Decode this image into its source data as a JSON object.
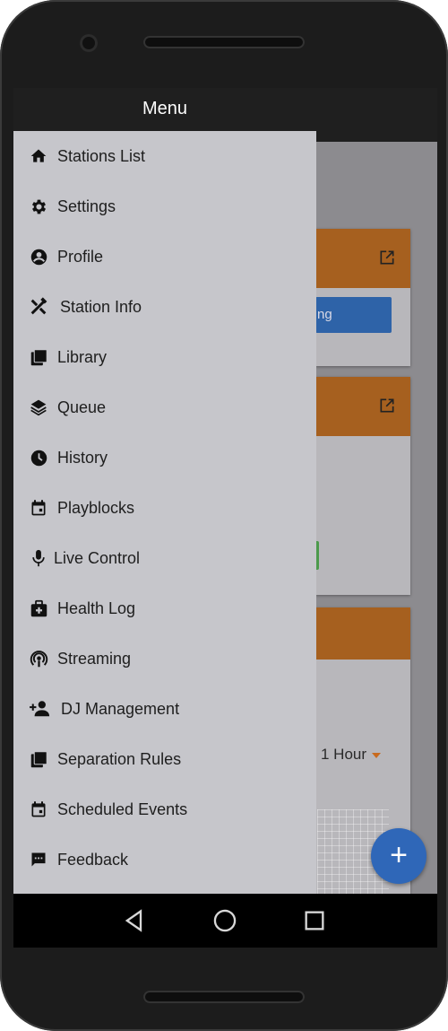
{
  "drawer": {
    "title": "Menu",
    "items": [
      {
        "label": "Stations List",
        "icon": "home-icon"
      },
      {
        "label": "Settings",
        "icon": "gear-icon"
      },
      {
        "label": "Profile",
        "icon": "account-circle-icon"
      },
      {
        "label": "Station Info",
        "icon": "tools-icon"
      },
      {
        "label": "Library",
        "icon": "library-icon"
      },
      {
        "label": "Queue",
        "icon": "layers-icon"
      },
      {
        "label": "History",
        "icon": "clock-icon"
      },
      {
        "label": "Playblocks",
        "icon": "calendar-icon"
      },
      {
        "label": "Live Control",
        "icon": "microphone-icon"
      },
      {
        "label": "Health Log",
        "icon": "medical-bag-icon"
      },
      {
        "label": "Streaming",
        "icon": "podcast-icon"
      },
      {
        "label": "DJ Management",
        "icon": "add-person-icon"
      },
      {
        "label": "Separation Rules",
        "icon": "library-icon"
      },
      {
        "label": "Scheduled Events",
        "icon": "calendar-icon"
      },
      {
        "label": "Feedback",
        "icon": "feedback-icon"
      }
    ]
  },
  "background": {
    "button_partial_label": "ng",
    "time_range": "1 Hour",
    "fab_label": "+"
  },
  "colors": {
    "drawer_bg": "#c6c6cb",
    "header_bg": "#1f1f1f",
    "accent_orange": "#a6601f",
    "accent_blue": "#2f67b8"
  },
  "navbar": {
    "buttons": [
      "back-icon",
      "home-circle-icon",
      "recents-square-icon"
    ]
  }
}
